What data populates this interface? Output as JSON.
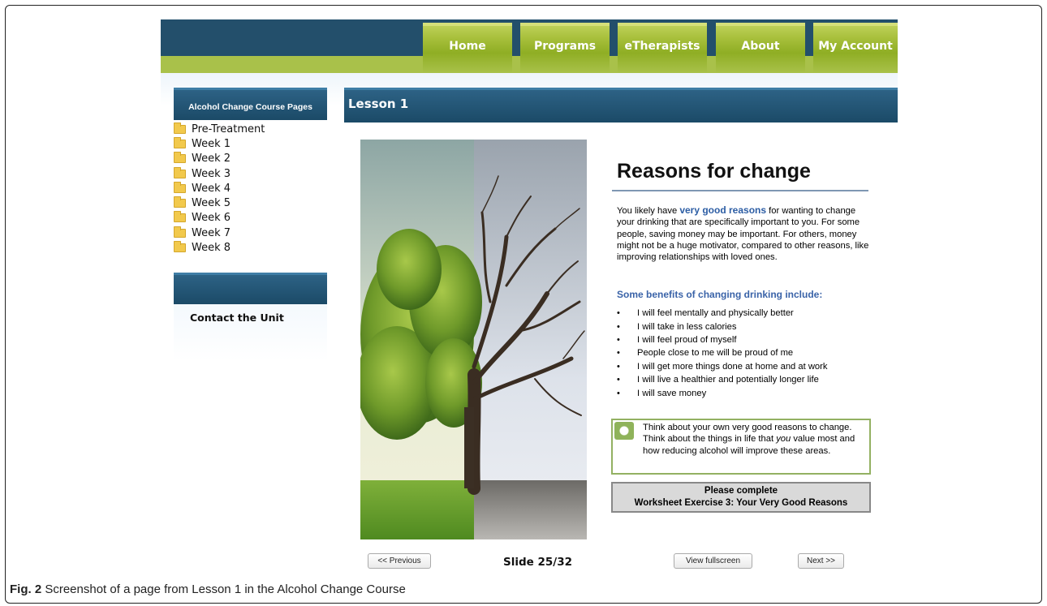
{
  "nav": {
    "items": [
      "Home",
      "Programs",
      "eTherapists",
      "About",
      "My Account"
    ]
  },
  "sidebar": {
    "header": "Alcohol Change Course Pages",
    "items": [
      "Pre-Treatment",
      "Week 1",
      "Week 2",
      "Week 3",
      "Week 4",
      "Week 5",
      "Week 6",
      "Week 7",
      "Week 8"
    ],
    "contact": "Contact the Unit"
  },
  "lesson": {
    "title": "Lesson 1"
  },
  "slide": {
    "title": "Reasons for change",
    "intro_before": "You likely have ",
    "intro_highlight": "very good reasons",
    "intro_after": " for wanting to change your drinking that are specifically important to you. For some people, saving money may be important. For others, money might not be a huge motivator, compared to other reasons, like improving relationships with loved ones.",
    "benefits_heading": "Some benefits of changing drinking include:",
    "benefits": [
      "I will feel mentally and physically better",
      "I will take in less calories",
      "I will feel proud of myself",
      "People close to me will be proud of me",
      "I will get more things done at home and at work",
      "I will live a healthier and potentially longer life",
      "I will save money"
    ],
    "think_before": "Think about your own very good reasons to change. Think about the things in life that ",
    "think_emph": "you",
    "think_after": " value most and how reducing alcohol will improve these areas.",
    "worksheet_line1": "Please complete",
    "worksheet_line2": "Worksheet Exercise 3: Your Very Good Reasons"
  },
  "controls": {
    "previous": "<< Previous",
    "slide_counter": "Slide 25/32",
    "fullscreen": "View fullscreen",
    "next": "Next >>"
  },
  "caption": {
    "label": "Fig. 2",
    "text": " Screenshot of a page from Lesson 1 in the Alcohol Change Course"
  },
  "icons": {
    "folder": "folder-icon",
    "think": "lightbulb-icon"
  },
  "colors": {
    "header_blue": "#234f6b",
    "nav_green": "#a9c14a",
    "highlight_blue": "#2c5da4"
  }
}
